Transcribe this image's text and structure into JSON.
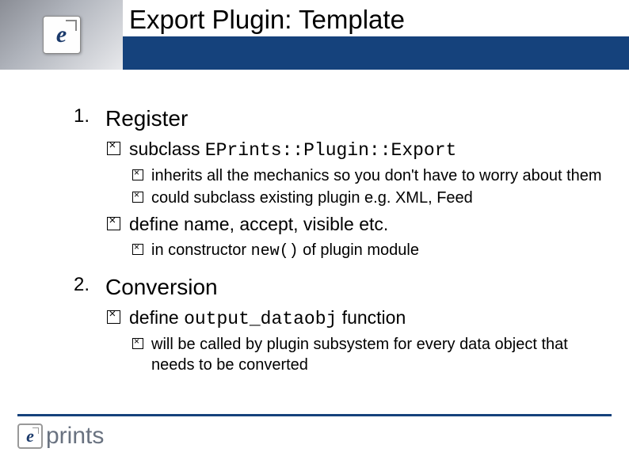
{
  "header": {
    "title": "Export Plugin: Template",
    "logo_letter": "e"
  },
  "list": {
    "item1": {
      "label": "Register",
      "sub1": {
        "text_before": "subclass ",
        "code": "EPrints::Plugin::Export",
        "sub": {
          "a": "inherits all the mechanics so you don't have to worry about them",
          "b": "could subclass existing plugin e.g. XML, Feed"
        }
      },
      "sub2": {
        "text": "define name, accept, visible etc.",
        "sub": {
          "a_before": "in constructor ",
          "a_code": "new()",
          "a_after": " of plugin module"
        }
      }
    },
    "item2": {
      "label": "Conversion",
      "sub1": {
        "text_before": "define ",
        "code": "output_dataobj",
        "text_after": " function",
        "sub": {
          "a": "will be called by plugin subsystem for every data object that needs to be converted"
        }
      }
    }
  },
  "footer": {
    "logo_e": "e",
    "logo_text": "prints"
  }
}
